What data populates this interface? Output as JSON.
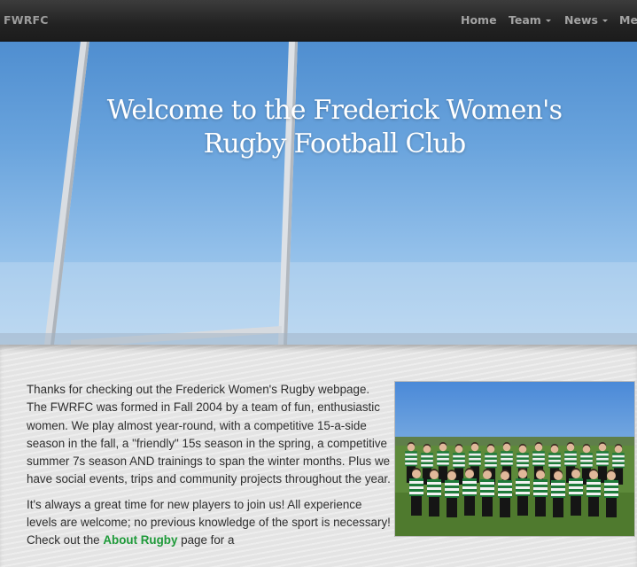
{
  "navbar": {
    "brand": "FWRFC",
    "items": [
      {
        "label": "Home",
        "dropdown": false
      },
      {
        "label": "Team",
        "dropdown": true
      },
      {
        "label": "News",
        "dropdown": true
      },
      {
        "label": "Me",
        "dropdown": false
      }
    ]
  },
  "hero": {
    "title_line1": "Welcome to the Frederick Women's",
    "title_line2": "Rugby Football Club"
  },
  "intro": {
    "paragraph1": "Thanks for checking out the Frederick Women's Rugby webpage. The FWRFC was formed in Fall 2004 by a team of fun, enthusiastic women. We play almost year-round, with a competitive 15-a-side season in the fall, a \"friendly\" 15s season in the spring, a competitive summer 7s season AND trainings to span the winter months. Plus we have social events, trips and community projects throughout the year.",
    "paragraph2_before": "It's always a great time for new players to join us! All experience levels are welcome; no previous knowledge of the sport is necessary! Check out the ",
    "paragraph2_link": "About Rugby",
    "paragraph2_after": " page for a"
  },
  "colors": {
    "navbar_bg": "#222222",
    "nav_text": "#a3a3a3",
    "link_green": "#1f9a3a",
    "sky_blue": "#6aa4dd"
  }
}
